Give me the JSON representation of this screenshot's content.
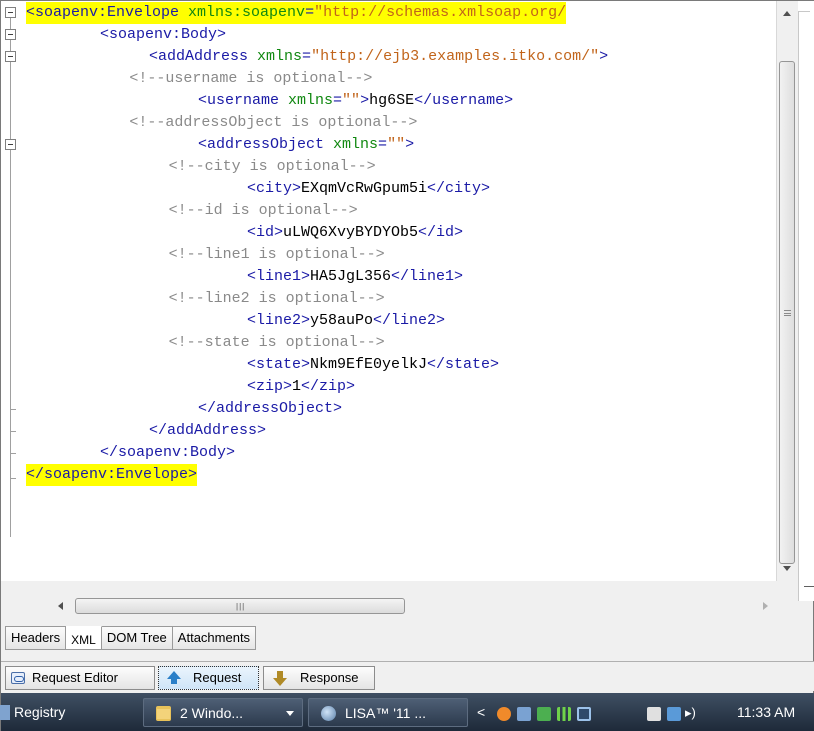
{
  "editor": {
    "lines": [
      {
        "indent": 0,
        "hl": true,
        "fold": "box",
        "segs": [
          [
            "t",
            "<soapenv:Envelope "
          ],
          [
            "a",
            "xmlns:soapenv"
          ],
          [
            "t",
            "="
          ],
          [
            "v",
            "\"http://schemas.xmlsoap.org/"
          ]
        ]
      },
      {
        "indent": 1,
        "fold": "box",
        "segs": [
          [
            "t",
            "<soapenv:Body>"
          ]
        ]
      },
      {
        "indent": 2,
        "fold": "box",
        "segs": [
          [
            "t",
            "<addAddress "
          ],
          [
            "a",
            "xmlns"
          ],
          [
            "t",
            "="
          ],
          [
            "v",
            "\"http://ejb3.examples.itko.com/\""
          ],
          [
            "t",
            ">"
          ]
        ]
      },
      {
        "indent": 1.6,
        "segs": [
          [
            "c",
            "<!--username is optional-->"
          ]
        ]
      },
      {
        "indent": 3,
        "segs": [
          [
            "t",
            "<username "
          ],
          [
            "a",
            "xmlns"
          ],
          [
            "t",
            "="
          ],
          [
            "v",
            "\"\""
          ],
          [
            "t",
            ">"
          ],
          [
            "x",
            "hg6SE"
          ],
          [
            "t",
            "</username>"
          ]
        ]
      },
      {
        "indent": 1.6,
        "segs": [
          [
            "c",
            "<!--addressObject is optional-->"
          ]
        ]
      },
      {
        "indent": 3,
        "fold": "box",
        "segs": [
          [
            "t",
            "<addressObject "
          ],
          [
            "a",
            "xmlns"
          ],
          [
            "t",
            "="
          ],
          [
            "v",
            "\"\""
          ],
          [
            "t",
            ">"
          ]
        ]
      },
      {
        "indent": 2.4,
        "segs": [
          [
            "c",
            "<!--city is optional-->"
          ]
        ]
      },
      {
        "indent": 4,
        "segs": [
          [
            "t",
            "<city>"
          ],
          [
            "x",
            "EXqmVcRwGpum5i"
          ],
          [
            "t",
            "</city>"
          ]
        ]
      },
      {
        "indent": 2.4,
        "segs": [
          [
            "c",
            "<!--id is optional-->"
          ]
        ]
      },
      {
        "indent": 4,
        "segs": [
          [
            "t",
            "<id>"
          ],
          [
            "x",
            "uLWQ6XvyBYDYOb5"
          ],
          [
            "t",
            "</id>"
          ]
        ]
      },
      {
        "indent": 2.4,
        "segs": [
          [
            "c",
            "<!--line1 is optional-->"
          ]
        ]
      },
      {
        "indent": 4,
        "segs": [
          [
            "t",
            "<line1>"
          ],
          [
            "x",
            "HA5JgL356"
          ],
          [
            "t",
            "</line1>"
          ]
        ]
      },
      {
        "indent": 2.4,
        "segs": [
          [
            "c",
            "<!--line2 is optional-->"
          ]
        ]
      },
      {
        "indent": 4,
        "segs": [
          [
            "t",
            "<line2>"
          ],
          [
            "x",
            "y58auPo"
          ],
          [
            "t",
            "</line2>"
          ]
        ]
      },
      {
        "indent": 2.4,
        "segs": [
          [
            "c",
            "<!--state is optional-->"
          ]
        ]
      },
      {
        "indent": 4,
        "segs": [
          [
            "t",
            "<state>"
          ],
          [
            "x",
            "Nkm9EfE0yelkJ"
          ],
          [
            "t",
            "</state>"
          ]
        ]
      },
      {
        "indent": 4,
        "segs": [
          [
            "t",
            "<zip>"
          ],
          [
            "x",
            "1"
          ],
          [
            "t",
            "</zip>"
          ]
        ]
      },
      {
        "indent": 3,
        "fold": "tick",
        "segs": [
          [
            "t",
            "</addressObject>"
          ]
        ]
      },
      {
        "indent": 2,
        "fold": "tick",
        "segs": [
          [
            "t",
            "</addAddress>"
          ]
        ]
      },
      {
        "indent": 1,
        "fold": "tick",
        "segs": [
          [
            "t",
            "</soapenv:Body>"
          ]
        ]
      },
      {
        "indent": 0,
        "hl": true,
        "fold": "end",
        "segs": [
          [
            "t",
            "</soapenv:Envelope>"
          ]
        ]
      }
    ]
  },
  "tabs": [
    {
      "label": "Headers",
      "active": false
    },
    {
      "label": "XML",
      "active": true
    },
    {
      "label": "DOM Tree",
      "active": false
    },
    {
      "label": "Attachments",
      "active": false
    }
  ],
  "modes": {
    "request_editor": "Request Editor",
    "request": "Request",
    "response": "Response"
  },
  "taskbar": {
    "registry": "Registry",
    "windows": "2 Windo...",
    "lisa": "LISA™ '11 ...",
    "clock": "11:33 AM"
  }
}
